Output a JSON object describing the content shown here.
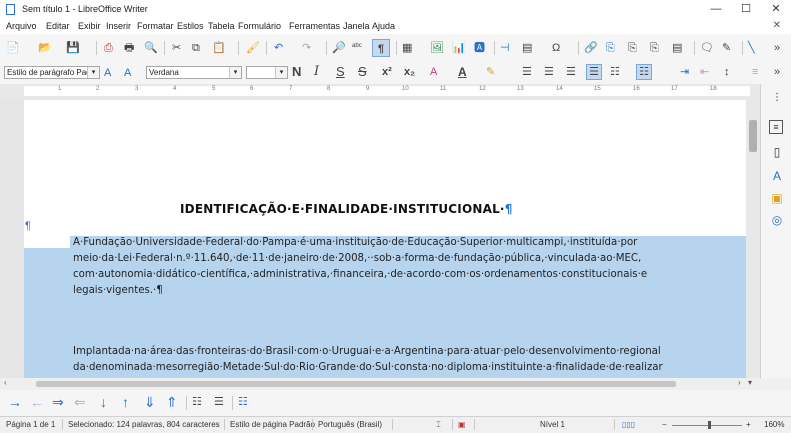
{
  "window": {
    "title": "Sem título 1 - LibreOffice Writer",
    "minimize": "—",
    "maximize": "☐",
    "close": "✕"
  },
  "menu": [
    "Arquivo",
    "Editar",
    "Exibir",
    "Inserir",
    "Formatar",
    "Estilos",
    "Tabela",
    "Formulário",
    "Ferramentas",
    "Janela",
    "Ajuda"
  ],
  "menu_close_doc": "✕",
  "formatting": {
    "paragraph_style": "Estilo de parágrafo Padrão",
    "font_name": "Verdana",
    "font_size": ""
  },
  "ruler_numbers": [
    "1",
    "2",
    "3",
    "4",
    "5",
    "6",
    "7",
    "8",
    "9",
    "10",
    "11",
    "12",
    "13",
    "14",
    "15",
    "16",
    "17",
    "18"
  ],
  "document": {
    "heading": "IDENTIFICAÇÃO·E·FINALIDADE·INSTITUCIONAL·",
    "pilcrow": "¶",
    "lines": [
      "A·Fundação·Universidade·Federal·do·Pampa·é·uma·instituição·de·Educação·Superior·multicampi,·instituída·por",
      "meio·da·Lei·Federal·n.º·11.640,·de·11·de·janeiro·de·2008,··sob·a·forma·de·fundação·pública,·vinculada·ao·MEC,",
      "com·autonomia·didático-científica,·administrativa,·financeira,·de·acordo·com·os·ordenamentos·constitucionais·e",
      "legais·vigentes.·¶",
      "Implantada·na·área·das·fronteiras·do·Brasil·com·o·Uruguai·e·a·Argentina·para·atuar·pelo·desenvolvimento·regional",
      "da·denominada·mesorregião·Metade·Sul·do·Rio·Grande·do·Sul·consta·no·diploma·instituinte·a·finalidade·de·realizar"
    ]
  },
  "status": {
    "page": "Página 1 de 1",
    "selection": "Selecionado: 124 palavras, 804 caracteres",
    "page_style": "Estilo de página Padrão",
    "language": "Português (Brasil)",
    "level": "Nível 1",
    "zoom": "160%"
  },
  "icons": {
    "new": "📄",
    "open": "📂",
    "save": "💾",
    "pdf": "⎙",
    "print": "🖶",
    "preview": "🔍",
    "cut": "✂",
    "copy": "⧉",
    "paste": "📋",
    "clone": "🖌",
    "undo": "↶",
    "redo": "↷",
    "find": "🔎",
    "spell": "ᵃᵇᶜ",
    "pilcrow": "¶",
    "table": "▦",
    "image": "🖼",
    "chart": "📊",
    "textbox": "🅰",
    "pagebreak": "⊣",
    "field": "▤",
    "special": "Ω",
    "link": "🔗",
    "footnote": "⎘",
    "comment": "🗨",
    "track": "✎",
    "line": "╲",
    "more": "»"
  }
}
